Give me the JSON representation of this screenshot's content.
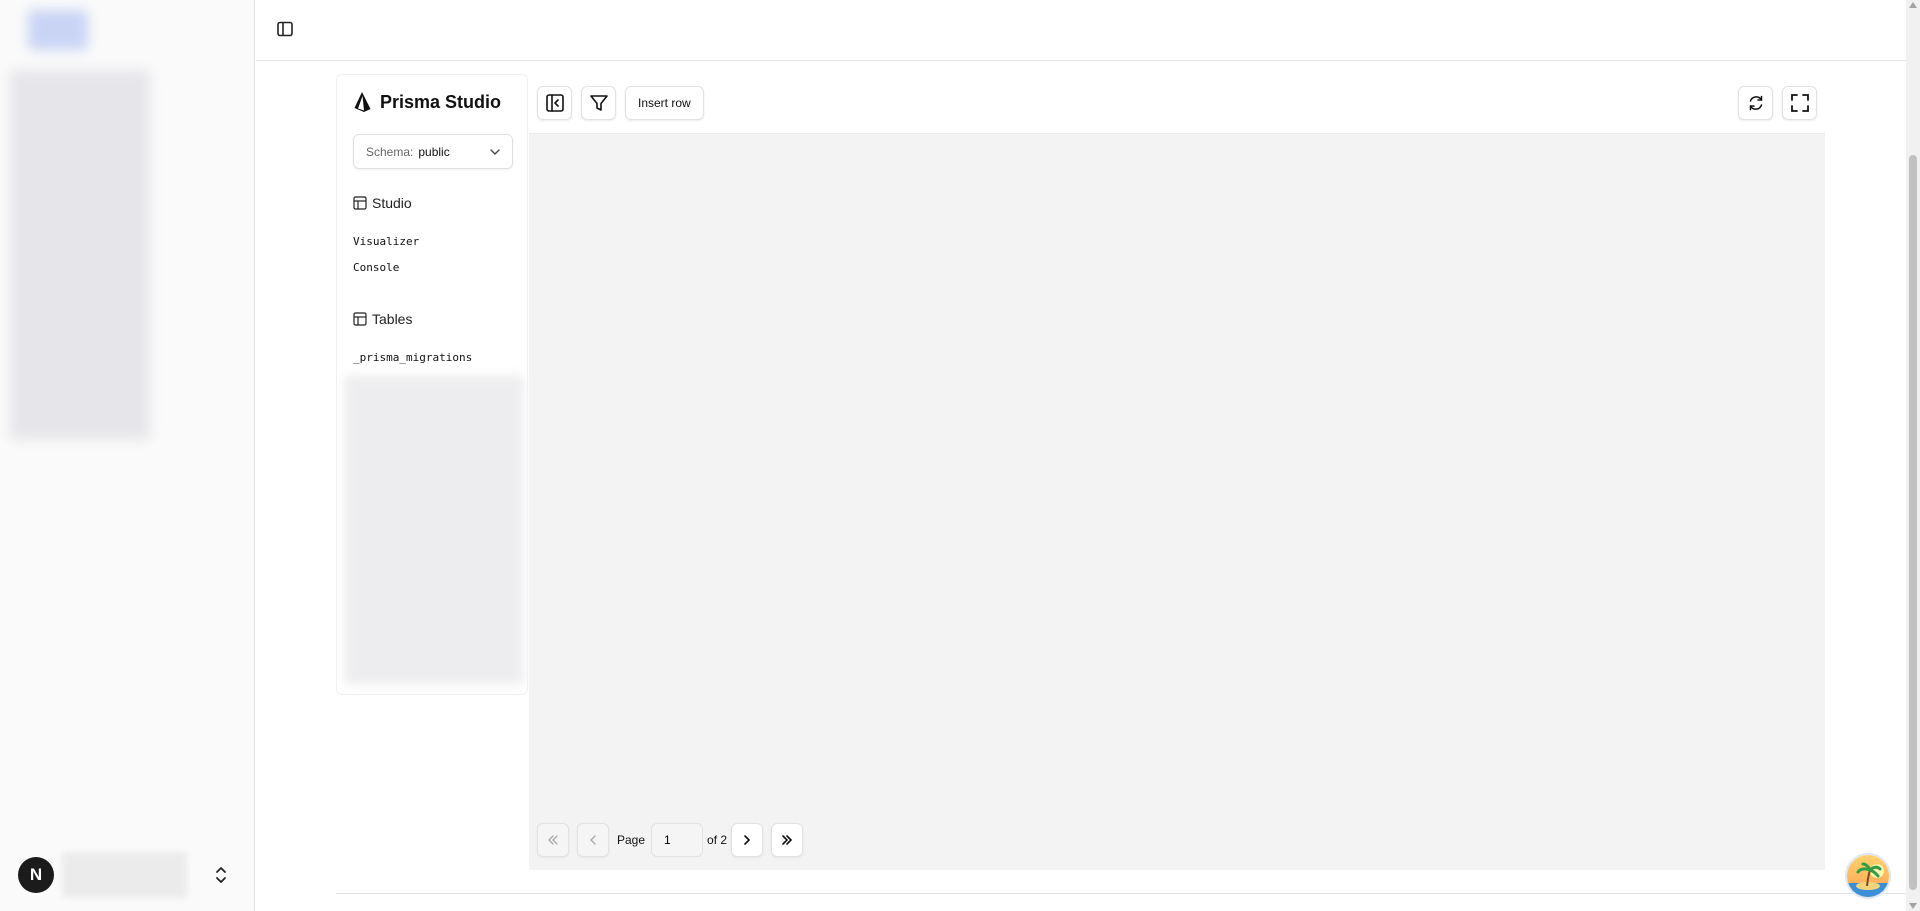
{
  "studio": {
    "brand_title": "Prisma Studio",
    "schema_label": "Schema:",
    "schema_value": "public",
    "studio_section": "Studio",
    "nav": [
      "Visualizer",
      "Console"
    ],
    "tables_section": "Tables",
    "tables": [
      "_prisma_migrations"
    ]
  },
  "toolbar": {
    "insert_row_label": "Insert row"
  },
  "pagination": {
    "page_label": "Page",
    "current_page": "1",
    "of_label": "of 2"
  },
  "user": {
    "avatar_initial": "N"
  },
  "colors": {
    "accent": "#1b1b1b",
    "grid_bg": "#f3f3f3"
  }
}
